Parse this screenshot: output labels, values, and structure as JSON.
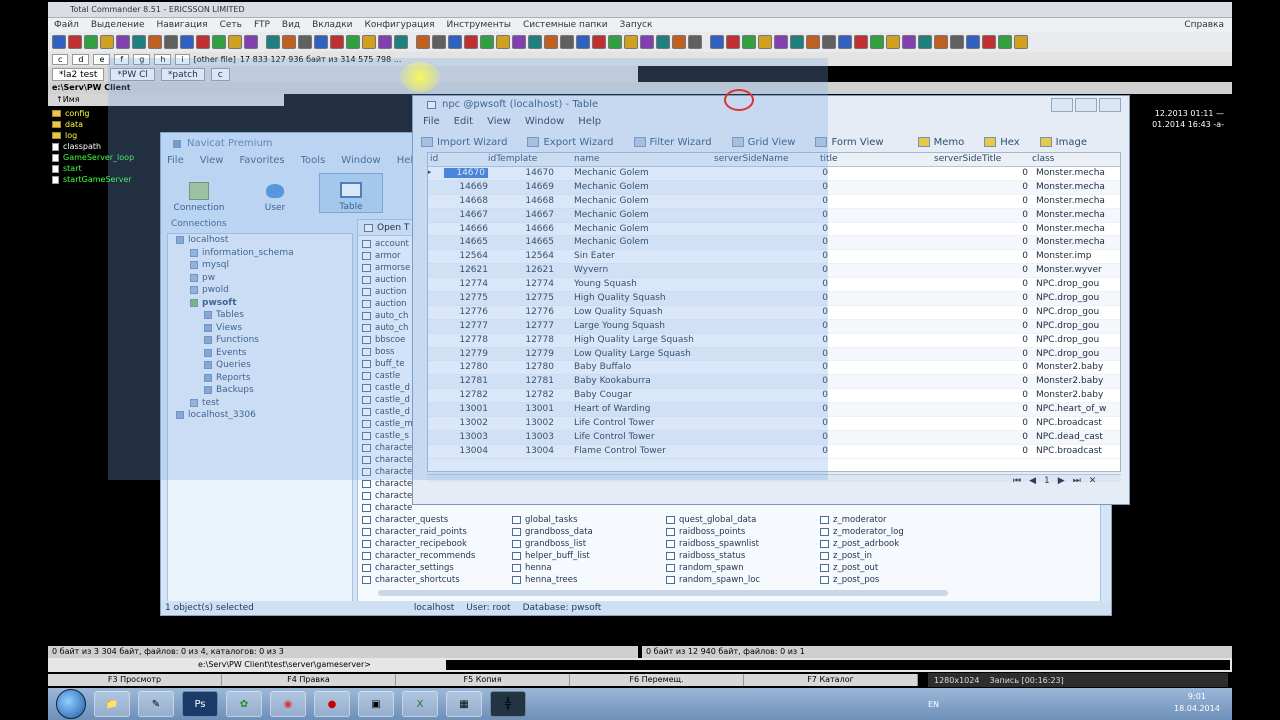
{
  "tc": {
    "title": "Total Commander 8.51 - ERICSSON LIMITED",
    "menu": [
      "Файл",
      "Выделение",
      "Навигация",
      "Сеть",
      "FTP",
      "Вид",
      "Вкладки",
      "Конфигурация",
      "Инструменты",
      "Системные папки",
      "Запуск"
    ],
    "help": "Справка",
    "other_file": "[other file]",
    "free_space": "17 833 127 936 байт из 314 575 798 ...",
    "tabs": [
      "*la2 test",
      "*PW Cl",
      "*patch",
      "c"
    ],
    "path": "e:\\Serv\\PW Client",
    "col_name": "↑Имя",
    "left_files": [
      {
        "name": "config",
        "type": "folder"
      },
      {
        "name": "data",
        "type": "folder"
      },
      {
        "name": "log",
        "type": "folder"
      },
      {
        "name": "classpath",
        "type": "file"
      },
      {
        "name": "GameServer_loop",
        "type": "file"
      },
      {
        "name": "start",
        "type": "file"
      },
      {
        "name": "startGameServer",
        "type": "file"
      }
    ],
    "right_dates": [
      "12.2013 01:11 —",
      "01.2014 16:43 -a-"
    ],
    "status_left": "0 байт из 3 304 байт, файлов: 0 из 4, каталогов: 0 из 3",
    "status_right": "0 байт из 12 940 байт, файлов: 0 из 1",
    "cmd_path": "e:\\Serv\\PW Client\\test\\server\\gameserver>",
    "fkeys": [
      "F3 Просмотр",
      "F4 Правка",
      "F5 Копия",
      "F6 Перемещ.",
      "F7 Каталог"
    ]
  },
  "navicat": {
    "title": "Navicat Premium",
    "menu": [
      "File",
      "View",
      "Favorites",
      "Tools",
      "Window",
      "Help"
    ],
    "ribbon": [
      {
        "label": "Connection",
        "icon": "connection-icon"
      },
      {
        "label": "User",
        "icon": "user-icon"
      },
      {
        "label": "Table",
        "icon": "table-icon"
      }
    ],
    "connections_label": "Connections",
    "open_table": "Open T",
    "tree": [
      {
        "label": "localhost",
        "level": 0,
        "kind": "conn"
      },
      {
        "label": "information_schema",
        "level": 1,
        "kind": "db"
      },
      {
        "label": "mysql",
        "level": 1,
        "kind": "db"
      },
      {
        "label": "pw",
        "level": 1,
        "kind": "db"
      },
      {
        "label": "pwold",
        "level": 1,
        "kind": "db"
      },
      {
        "label": "pwsoft",
        "level": 1,
        "kind": "sel"
      },
      {
        "label": "Tables",
        "level": 2,
        "kind": "obj"
      },
      {
        "label": "Views",
        "level": 2,
        "kind": "obj"
      },
      {
        "label": "Functions",
        "level": 2,
        "kind": "obj"
      },
      {
        "label": "Events",
        "level": 2,
        "kind": "obj"
      },
      {
        "label": "Queries",
        "level": 2,
        "kind": "obj"
      },
      {
        "label": "Reports",
        "level": 2,
        "kind": "obj"
      },
      {
        "label": "Backups",
        "level": 2,
        "kind": "obj"
      },
      {
        "label": "test",
        "level": 1,
        "kind": "db"
      },
      {
        "label": "localhost_3306",
        "level": 0,
        "kind": "conn"
      }
    ],
    "objects_col1": [
      "account",
      "armor",
      "armorse",
      "auction",
      "auction",
      "auction",
      "auto_ch",
      "auto_ch",
      "bbscoe",
      "boss",
      "buff_te",
      "castle",
      "castle_d",
      "castle_d",
      "castle_d",
      "castle_m",
      "castle_s",
      "characte",
      "characte",
      "characte",
      "characte",
      "characte",
      "characte",
      "character_quests",
      "character_raid_points",
      "character_recipebook",
      "character_recommends",
      "character_settings",
      "character_shortcuts"
    ],
    "objects_col2": [
      "global_tasks",
      "grandboss_data",
      "grandboss_list",
      "helper_buff_list",
      "henna",
      "henna_trees"
    ],
    "objects_col3": [
      "quest_global_data",
      "raidboss_points",
      "raidboss_spawnlist",
      "raidboss_status",
      "random_spawn",
      "random_spawn_loc"
    ],
    "objects_col4": [
      "z_moderator",
      "z_moderator_log",
      "z_post_adrbook",
      "z_post_in",
      "z_post_out",
      "z_post_pos"
    ],
    "status": "1 object(s) selected",
    "status_conn": "localhost",
    "status_user": "User: root",
    "status_db": "Database: pwsoft"
  },
  "npc": {
    "title": "npc @pwsoft (localhost) - Table",
    "menu": [
      "File",
      "Edit",
      "View",
      "Window",
      "Help"
    ],
    "toolbar": [
      "Import Wizard",
      "Export Wizard",
      "Filter Wizard",
      "Grid View",
      "Form View",
      "Memo",
      "Hex",
      "Image"
    ],
    "columns": [
      "id",
      "idTemplate",
      "name",
      "serverSideName",
      "title",
      "serverSideTitle",
      "class"
    ],
    "rows": [
      [
        "14670",
        "14670",
        "Mechanic Golem",
        "0",
        "0",
        "Monster.mecha"
      ],
      [
        "14669",
        "14669",
        "Mechanic Golem",
        "0",
        "0",
        "Monster.mecha"
      ],
      [
        "14668",
        "14668",
        "Mechanic Golem",
        "0",
        "0",
        "Monster.mecha"
      ],
      [
        "14667",
        "14667",
        "Mechanic Golem",
        "0",
        "0",
        "Monster.mecha"
      ],
      [
        "14666",
        "14666",
        "Mechanic Golem",
        "0",
        "0",
        "Monster.mecha"
      ],
      [
        "14665",
        "14665",
        "Mechanic Golem",
        "0",
        "0",
        "Monster.mecha"
      ],
      [
        "12564",
        "12564",
        "Sin Eater",
        "0",
        "0",
        "Monster.imp"
      ],
      [
        "12621",
        "12621",
        "Wyvern",
        "0",
        "0",
        "Monster.wyver"
      ],
      [
        "12774",
        "12774",
        "Young Squash",
        "0",
        "0",
        "NPC.drop_gou"
      ],
      [
        "12775",
        "12775",
        "High Quality Squash",
        "0",
        "0",
        "NPC.drop_gou"
      ],
      [
        "12776",
        "12776",
        "Low Quality Squash",
        "0",
        "0",
        "NPC.drop_gou"
      ],
      [
        "12777",
        "12777",
        "Large Young Squash",
        "0",
        "0",
        "NPC.drop_gou"
      ],
      [
        "12778",
        "12778",
        "High Quality Large Squash",
        "0",
        "0",
        "NPC.drop_gou"
      ],
      [
        "12779",
        "12779",
        "Low Quality Large Squash",
        "0",
        "0",
        "NPC.drop_gou"
      ],
      [
        "12780",
        "12780",
        "Baby Buffalo",
        "0",
        "0",
        "Monster2.baby"
      ],
      [
        "12781",
        "12781",
        "Baby Kookaburra",
        "0",
        "0",
        "Monster2.baby"
      ],
      [
        "12782",
        "12782",
        "Baby Cougar",
        "0",
        "0",
        "Monster2.baby"
      ],
      [
        "13001",
        "13001",
        "Heart of Warding",
        "0",
        "0",
        "NPC.heart_of_w"
      ],
      [
        "13002",
        "13002",
        "Life Control Tower",
        "0",
        "0",
        "NPC.broadcast"
      ],
      [
        "13003",
        "13003",
        "Life Control Tower",
        "0",
        "0",
        "NPC.dead_cast"
      ],
      [
        "13004",
        "13004",
        "Flame Control Tower",
        "0",
        "0",
        "NPC.broadcast"
      ]
    ],
    "page": "1"
  },
  "taskbar": {
    "lang": "EN",
    "time": "9:01",
    "date": "18.04.2014",
    "rec_size": "1280x1024",
    "rec_label": "Запись [00:16:23]"
  },
  "colors": {
    "selection": "#3a78d6",
    "navicat_bg": "#d5e5f6",
    "overlay": "rgba(120,170,230,0.28)"
  }
}
